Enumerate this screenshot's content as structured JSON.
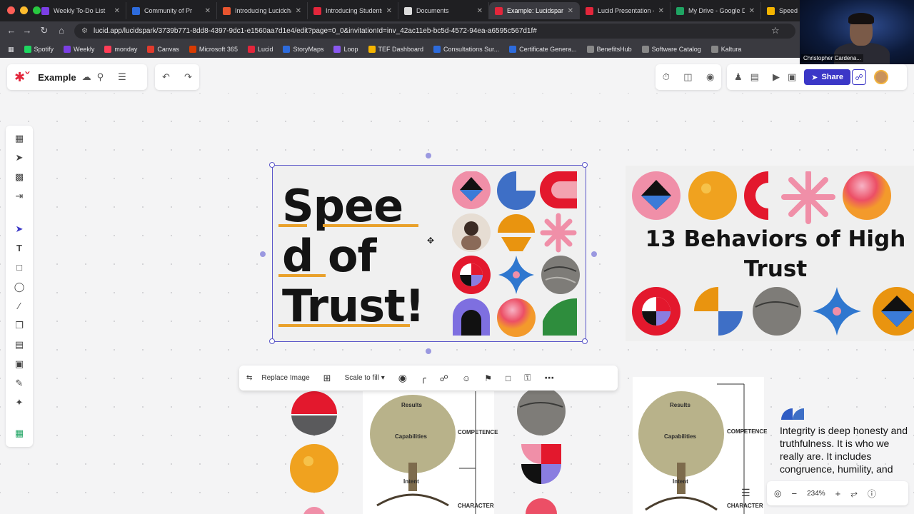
{
  "browser": {
    "tabs": [
      {
        "label": "Weekly To-Do List",
        "color": "#7b3fe4",
        "active": false
      },
      {
        "label": "Community of Pr",
        "color": "#2d6bdc",
        "active": false
      },
      {
        "label": "Introducing Lucidcha",
        "color": "#e8552f",
        "active": false
      },
      {
        "label": "Introducing Students",
        "color": "#e3263b",
        "active": false
      },
      {
        "label": "Documents",
        "color": "#dddddd",
        "active": false
      },
      {
        "label": "Example: Lucidspark",
        "color": "#e3263b",
        "active": true
      },
      {
        "label": "Lucid Presentation -",
        "color": "#e3263b",
        "active": false
      },
      {
        "label": "My Drive - Google Dr",
        "color": "#1fa463",
        "active": false
      },
      {
        "label": "Speed",
        "color": "#f4b400",
        "active": false
      }
    ],
    "url": "lucid.app/lucidspark/3739b771-8dd8-4397-9dc1-e1560aa7d1e4/edit?page=0_0&invitationId=inv_42ac11eb-bc5d-4572-94ea-a6595c567d1f#",
    "bookmarks": [
      {
        "label": "Spotify",
        "color": "#1ed760"
      },
      {
        "label": "Weekly",
        "color": "#7b3fe4"
      },
      {
        "label": "monday",
        "color": "#ff3d57"
      },
      {
        "label": "Canvas",
        "color": "#e13b2d"
      },
      {
        "label": "Microsoft 365",
        "color": "#d83b01"
      },
      {
        "label": "Lucid",
        "color": "#e3263b"
      },
      {
        "label": "StoryMaps",
        "color": "#2d6bdc"
      },
      {
        "label": "Loop",
        "color": "#8a58f0"
      },
      {
        "label": "TEF Dashboard",
        "color": "#f4b400"
      },
      {
        "label": "Consultations Sur...",
        "color": "#2d6bdc"
      },
      {
        "label": "Certificate Genera...",
        "color": "#2d6bdc"
      },
      {
        "label": "BenefitsHub",
        "color": "#888888"
      },
      {
        "label": "Software Catalog",
        "color": "#888888"
      },
      {
        "label": "Kaltura",
        "color": "#888888"
      }
    ]
  },
  "webcam": {
    "name": "Christopher Cardena..."
  },
  "app": {
    "doc_title": "Example",
    "share_label": "Share"
  },
  "slide_main": {
    "title_lines": [
      "Spee",
      "d of",
      "Trust!"
    ]
  },
  "slide_right": {
    "title": "13 Behaviors of High Trust"
  },
  "context_toolbar": {
    "replace_image": "Replace Image",
    "scale": "Scale to fill"
  },
  "tree": {
    "results": "Results",
    "capabilities": "Capabilities",
    "intent": "Intent",
    "competence": "COMPETENCE",
    "character": "CHARACTER"
  },
  "integrity_text": "Integrity is deep honesty and truthfulness. It is who we really are. It includes congruence, humility, and",
  "zoom": "234%",
  "colors": {
    "accent": "#3b37c7",
    "lucid_red": "#e3263b",
    "underline": "#e9a12b"
  }
}
